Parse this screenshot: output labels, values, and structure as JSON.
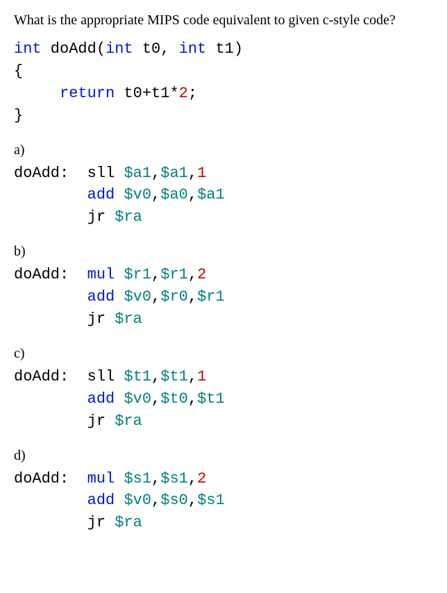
{
  "question": "What is the appropriate MIPS code equivalent to given c-style code?",
  "ccode": {
    "sig_int1": "int",
    "sig_fn": " doAdd(",
    "sig_int2": "int",
    "sig_p1": " t0, ",
    "sig_int3": "int",
    "sig_p2": " t1)",
    "lbrace": "{",
    "ret_kw": "return",
    "ret_expr_a": " t0+t1*",
    "ret_num": "2",
    "ret_semi": ";",
    "rbrace": "}"
  },
  "options": {
    "a": {
      "label": "a)",
      "doadd": "doAdd:",
      "l1_op": "sll ",
      "l1_r1": "$a1",
      "l1_c1": ",",
      "l1_r2": "$a1",
      "l1_c2": ",",
      "l1_n": "1",
      "l2_op": "add ",
      "l2_r1": "$v0",
      "l2_c1": ",",
      "l2_r2": "$a0",
      "l2_c2": ",",
      "l2_r3": "$a1",
      "l3_op": "jr ",
      "l3_r1": "$ra"
    },
    "b": {
      "label": "b)",
      "doadd": "doAdd:",
      "l1_op": "mul ",
      "l1_r1": "$r1",
      "l1_c1": ",",
      "l1_r2": "$r1",
      "l1_c2": ",",
      "l1_n": "2",
      "l2_op": "add ",
      "l2_r1": "$v0",
      "l2_c1": ",",
      "l2_r2": "$r0",
      "l2_c2": ",",
      "l2_r3": "$r1",
      "l3_op": "jr ",
      "l3_r1": "$ra"
    },
    "c": {
      "label": "c)",
      "doadd": "doAdd:",
      "l1_op": "sll ",
      "l1_r1": "$t1",
      "l1_c1": ",",
      "l1_r2": "$t1",
      "l1_c2": ",",
      "l1_n": "1",
      "l2_op": "add ",
      "l2_r1": "$v0",
      "l2_c1": ",",
      "l2_r2": "$t0",
      "l2_c2": ",",
      "l2_r3": "$t1",
      "l3_op": "jr ",
      "l3_r1": "$ra"
    },
    "d": {
      "label": "d)",
      "doadd": "doAdd:",
      "l1_op": "mul ",
      "l1_r1": "$s1",
      "l1_c1": ",",
      "l1_r2": "$s1",
      "l1_c2": ",",
      "l1_n": "2",
      "l2_op": "add ",
      "l2_r1": "$v0",
      "l2_c1": ",",
      "l2_r2": "$s0",
      "l2_c2": ",",
      "l2_r3": "$s1",
      "l3_op": "jr ",
      "l3_r1": "$ra"
    }
  }
}
